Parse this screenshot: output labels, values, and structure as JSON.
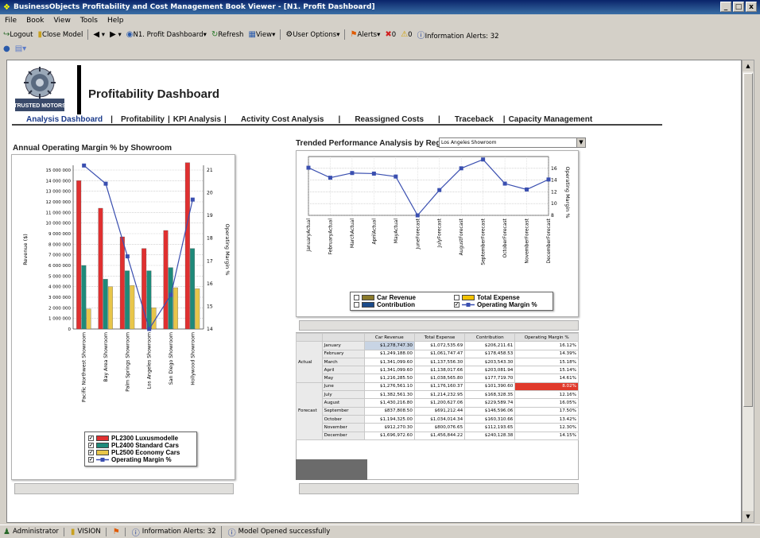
{
  "window": {
    "title": "BusinessObjects Profitability and Cost Management Book Viewer - [N1. Profit Dashboard]",
    "controls": [
      "_",
      "□",
      "x"
    ]
  },
  "menu": [
    "File",
    "Book",
    "View",
    "Tools",
    "Help"
  ],
  "toolbar": {
    "logout": "Logout",
    "close_model": "Close Model",
    "dashboard": "N1. Profit Dashboard",
    "refresh": "Refresh",
    "view": "View",
    "user_options": "User Options",
    "alerts": "Alerts",
    "alert_count_red": "0",
    "alert_count_yellow": "0",
    "info_alerts": "Information Alerts: 32"
  },
  "header": {
    "logo_text": "TRUSTED MOTORS",
    "title": "Profitability Dashboard"
  },
  "nav": [
    {
      "label": "Analysis Dashboard",
      "active": true
    },
    {
      "label": "Profitability",
      "active": false
    },
    {
      "label": "KPI Analysis",
      "active": false
    },
    {
      "label": "Activity Cost Analysis",
      "active": false
    },
    {
      "label": "Reassigned Costs",
      "active": false
    },
    {
      "label": "Traceback",
      "active": false
    },
    {
      "label": "Capacity Management",
      "active": false
    }
  ],
  "left_panel": {
    "title": "Annual Operating Margin % by Showroom",
    "legend": [
      {
        "label": "PL2300 Luxusmodelle",
        "color": "#e03030",
        "checked": true
      },
      {
        "label": "PL2400 Standard Cars",
        "color": "#1e8a7a",
        "checked": true
      },
      {
        "label": "PL2500 Economy Cars",
        "color": "#e8c64a",
        "checked": true
      },
      {
        "label": "Operating Margin %",
        "color": "#3a4fb0",
        "checked": true
      }
    ]
  },
  "right_panel": {
    "title": "Trended Performance Analysis by Region",
    "region_select": "Los Angeles Showroom",
    "legend": [
      {
        "label": "Car Revenue",
        "color": "#8a7a2a",
        "checked": false
      },
      {
        "label": "Total Expense",
        "color": "#f2c200",
        "checked": false
      },
      {
        "label": "Contribution",
        "color": "#1a4a8a",
        "checked": false
      },
      {
        "label": "Operating Margin %",
        "color": "#3a4fb0",
        "checked": true
      }
    ]
  },
  "chart_data": [
    {
      "type": "bar",
      "title": "Annual Operating Margin % by Showroom",
      "ylabel": "Revenue ($)",
      "y2label": "Operating Margin %",
      "ylim": [
        0,
        15000000
      ],
      "y2lim": [
        14,
        21
      ],
      "y_ticks": [
        "0",
        "1 000 000",
        "2 000 000",
        "3 000 000",
        "4 000 000",
        "5 000 000",
        "6 000 000",
        "7 000 000",
        "8 000 000",
        "9 000 000",
        "10 000 000",
        "11 000 000",
        "12 000 000",
        "13 000 000",
        "14 000 000",
        "15 000 000"
      ],
      "y2_ticks": [
        "14",
        "15",
        "16",
        "17",
        "18",
        "19",
        "20",
        "21"
      ],
      "categories": [
        "Pacific Northwest Showroom",
        "Bay Area Showroom",
        "Palm Springs Showroom",
        "Los Angeles Showroom",
        "San Diego Showroom",
        "Hollywood Showroom"
      ],
      "series": [
        {
          "name": "PL2300 Luxusmodelle",
          "type": "bar",
          "values": [
            14000000,
            11400000,
            8700000,
            7600000,
            9300000,
            15700000
          ]
        },
        {
          "name": "PL2400 Standard Cars",
          "type": "bar",
          "values": [
            6000000,
            4700000,
            5500000,
            5500000,
            5800000,
            7600000
          ]
        },
        {
          "name": "PL2500 Economy Cars",
          "type": "bar",
          "values": [
            1900000,
            4000000,
            4100000,
            2000000,
            3900000,
            3800000
          ]
        },
        {
          "name": "Operating Margin %",
          "type": "line",
          "axis": "y2",
          "values": [
            21.2,
            20.4,
            17.2,
            14.0,
            15.5,
            19.7
          ]
        }
      ],
      "grid": true,
      "legend": "bottom"
    },
    {
      "type": "line",
      "title": "Trended Performance Analysis by Region",
      "y2label": "Operating Margin %",
      "y2lim": [
        8,
        18
      ],
      "y2_ticks": [
        "8",
        "10",
        "12",
        "14",
        "16"
      ],
      "categories": [
        "JanuaryActual",
        "FebruaryActual",
        "MarchActual",
        "AprilActual",
        "MayActual",
        "JuneForecast",
        "JulyForecast",
        "AugustForecast",
        "SeptemberForecast",
        "OctoberForecast",
        "NovemberForecast",
        "DecemberForecast"
      ],
      "series": [
        {
          "name": "Operating Margin %",
          "values": [
            16.1,
            14.4,
            15.2,
            15.1,
            14.6,
            8.0,
            12.3,
            16.0,
            17.5,
            13.4,
            12.4,
            14.1
          ]
        }
      ],
      "grid": true,
      "legend": "bottom"
    }
  ],
  "grid": {
    "headers": [
      "",
      "",
      "Car Revenue",
      "Total Expense",
      "Contribution",
      "Operating Margin %"
    ],
    "groups": [
      {
        "label": "Actual",
        "rows": [
          {
            "month": "January",
            "car_revenue": "$1,278,747.30",
            "total_expense": "$1,072,535.69",
            "contribution": "$206,211.61",
            "margin": "16.12%"
          },
          {
            "month": "February",
            "car_revenue": "$1,249,188.00",
            "total_expense": "$1,061,747.47",
            "contribution": "$178,458.53",
            "margin": "14.39%"
          },
          {
            "month": "March",
            "car_revenue": "$1,341,099.60",
            "total_expense": "$1,137,556.30",
            "contribution": "$203,543.30",
            "margin": "15.18%"
          },
          {
            "month": "April",
            "car_revenue": "$1,341,099.60",
            "total_expense": "$1,138,017.66",
            "contribution": "$203,081.94",
            "margin": "15.14%"
          },
          {
            "month": "May",
            "car_revenue": "$1,216,285.50",
            "total_expense": "$1,038,565.80",
            "contribution": "$177,719.70",
            "margin": "14.61%"
          }
        ]
      },
      {
        "label": "Forecast",
        "rows": [
          {
            "month": "June",
            "car_revenue": "$1,276,561.10",
            "total_expense": "$1,176,160.37",
            "contribution": "$101,390.60",
            "margin": "8.02%"
          },
          {
            "month": "July",
            "car_revenue": "$1,382,561.30",
            "total_expense": "$1,214,232.95",
            "contribution": "$168,328.35",
            "margin": "12.16%"
          },
          {
            "month": "August",
            "car_revenue": "$1,430,216.80",
            "total_expense": "$1,200,627.06",
            "contribution": "$229,589.74",
            "margin": "16.05%"
          },
          {
            "month": "September",
            "car_revenue": "$837,808.50",
            "total_expense": "$691,212.44",
            "contribution": "$146,596.06",
            "margin": "17.50%"
          },
          {
            "month": "October",
            "car_revenue": "$1,194,325.00",
            "total_expense": "$1,034,014.34",
            "contribution": "$160,310.66",
            "margin": "13.42%"
          },
          {
            "month": "November",
            "car_revenue": "$912,270.30",
            "total_expense": "$800,076.65",
            "contribution": "$112,193.65",
            "margin": "12.30%"
          },
          {
            "month": "December",
            "car_revenue": "$1,696,972.60",
            "total_expense": "$1,456,844.22",
            "contribution": "$240,128.38",
            "margin": "14.15%"
          }
        ]
      }
    ]
  },
  "status": {
    "user": "Administrator",
    "model": "VISION",
    "info_alerts": "Information Alerts: 32",
    "message": "Model Opened successfully"
  }
}
